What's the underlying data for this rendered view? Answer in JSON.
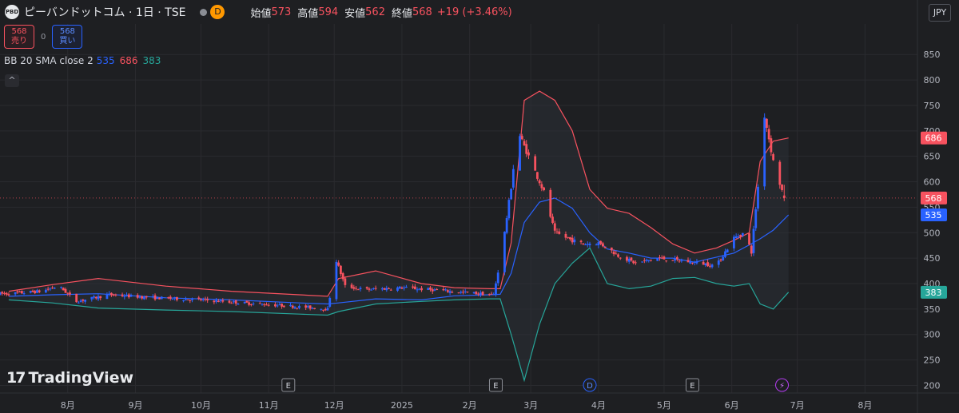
{
  "header": {
    "logo": "PBD",
    "title": "ピーバンドットコム · 1日 · TSE",
    "exchange_badge": "D",
    "ohlc": [
      {
        "label": "始値",
        "value": "573"
      },
      {
        "label": "高値",
        "value": "594"
      },
      {
        "label": "安値",
        "value": "562"
      },
      {
        "label": "終値",
        "value": "568"
      }
    ],
    "change": "+19 (+3.46%)"
  },
  "trade": {
    "sell_price": "568",
    "sell_label": "売り",
    "spread": "0",
    "buy_price": "568",
    "buy_label": "買い"
  },
  "indicator": {
    "name": "BB 20 SMA close 2",
    "basis": "535",
    "upper": "686",
    "lower": "383"
  },
  "collapse_label": "^",
  "currency": "JPY",
  "watermark": "TradingView",
  "colors": {
    "up": "#2962ff",
    "down": "#f7525f",
    "basis": "#2962ff",
    "upper": "#f7525f",
    "lower": "#26a69a",
    "band_fill": "#2b3036",
    "bg": "#1e1f22",
    "grid": "#2a2b2f"
  },
  "chart_data": {
    "type": "candlestick",
    "yaxis_side": "right",
    "ylim": [
      185,
      910
    ],
    "yticks": [
      200,
      250,
      300,
      350,
      400,
      450,
      500,
      550,
      600,
      650,
      700,
      750,
      800,
      850
    ],
    "price_labels": [
      {
        "value": 686,
        "text": "686",
        "color": "#f7525f"
      },
      {
        "value": 568,
        "text": "568",
        "color": "#f7525f"
      },
      {
        "value": 535,
        "text": "535",
        "color": "#2962ff"
      },
      {
        "value": 383,
        "text": "383",
        "color": "#26a69a"
      }
    ],
    "last_price": 568,
    "xaxis": {
      "ticks": [
        {
          "label": "8月",
          "date": "2024-08-01"
        },
        {
          "label": "9月",
          "date": "2024-09-01"
        },
        {
          "label": "10月",
          "date": "2024-10-01"
        },
        {
          "label": "11月",
          "date": "2024-11-01"
        },
        {
          "label": "12月",
          "date": "2024-12-01"
        },
        {
          "label": "2025",
          "date": "2025-01-01"
        },
        {
          "label": "2月",
          "date": "2025-02-01"
        },
        {
          "label": "3月",
          "date": "2025-03-01"
        },
        {
          "label": "4月",
          "date": "2025-04-01"
        },
        {
          "label": "5月",
          "date": "2025-05-01"
        },
        {
          "label": "6月",
          "date": "2025-06-01"
        },
        {
          "label": "7月",
          "date": "2025-07-01"
        },
        {
          "label": "8月",
          "date": "2025-08-01"
        }
      ]
    },
    "events": [
      {
        "label": "E",
        "date": "2024-11-10",
        "kind": "earnings"
      },
      {
        "label": "E",
        "date": "2025-02-13",
        "kind": "earnings"
      },
      {
        "label": "D",
        "date": "2025-03-28",
        "kind": "dividend"
      },
      {
        "label": "E",
        "date": "2025-05-14",
        "kind": "earnings"
      },
      {
        "label": "⚡",
        "date": "2025-06-24",
        "kind": "split"
      }
    ],
    "bands_anchors": {
      "dates": [
        "2024-07-05",
        "2024-07-25",
        "2024-08-15",
        "2024-09-15",
        "2024-10-15",
        "2024-11-15",
        "2024-11-28",
        "2024-12-03",
        "2024-12-20",
        "2025-01-10",
        "2025-01-25",
        "2025-02-10",
        "2025-02-15",
        "2025-02-20",
        "2025-02-26",
        "2025-03-05",
        "2025-03-12",
        "2025-03-20",
        "2025-03-28",
        "2025-04-05",
        "2025-04-15",
        "2025-04-25",
        "2025-05-05",
        "2025-05-15",
        "2025-05-25",
        "2025-06-02",
        "2025-06-09",
        "2025-06-14",
        "2025-06-20",
        "2025-06-27"
      ],
      "upper": [
        385,
        398,
        410,
        395,
        385,
        378,
        375,
        410,
        425,
        400,
        392,
        390,
        390,
        480,
        760,
        778,
        760,
        700,
        585,
        548,
        538,
        510,
        478,
        460,
        470,
        485,
        500,
        640,
        680,
        686
      ],
      "basis": [
        375,
        378,
        380,
        372,
        368,
        362,
        360,
        362,
        370,
        368,
        376,
        378,
        379,
        420,
        520,
        560,
        568,
        548,
        500,
        468,
        460,
        450,
        450,
        442,
        452,
        460,
        476,
        488,
        505,
        535
      ],
      "lower": [
        368,
        362,
        352,
        348,
        345,
        340,
        338,
        345,
        360,
        365,
        368,
        370,
        370,
        300,
        210,
        320,
        400,
        440,
        470,
        400,
        390,
        395,
        410,
        412,
        400,
        395,
        400,
        360,
        350,
        383
      ]
    },
    "candle_anchors": {
      "dates": [
        "2024-07-05",
        "2024-07-20",
        "2024-07-28",
        "2024-08-05",
        "2024-08-20",
        "2024-09-10",
        "2024-10-01",
        "2024-10-20",
        "2024-11-10",
        "2024-11-28",
        "2024-12-02",
        "2024-12-06",
        "2024-12-15",
        "2025-01-01",
        "2025-01-20",
        "2025-02-12",
        "2025-02-16",
        "2025-02-20",
        "2025-02-23",
        "2025-02-27",
        "2025-03-03",
        "2025-03-07",
        "2025-03-12",
        "2025-03-20",
        "2025-03-25",
        "2025-04-01",
        "2025-04-05",
        "2025-04-10",
        "2025-04-18",
        "2025-04-28",
        "2025-05-08",
        "2025-05-18",
        "2025-05-25",
        "2025-06-02",
        "2025-06-07",
        "2025-06-10",
        "2025-06-13",
        "2025-06-16",
        "2025-06-20",
        "2025-06-25"
      ],
      "close": [
        380,
        385,
        395,
        365,
        378,
        372,
        368,
        362,
        356,
        350,
        445,
        395,
        388,
        392,
        386,
        378,
        470,
        590,
        700,
        660,
        620,
        580,
        500,
        485,
        478,
        480,
        470,
        455,
        440,
        450,
        445,
        440,
        435,
        490,
        500,
        462,
        590,
        730,
        640,
        568
      ]
    },
    "ohlc_last": {
      "date": "2025-06-25",
      "open": 573,
      "high": 594,
      "low": 562,
      "close": 568
    }
  }
}
